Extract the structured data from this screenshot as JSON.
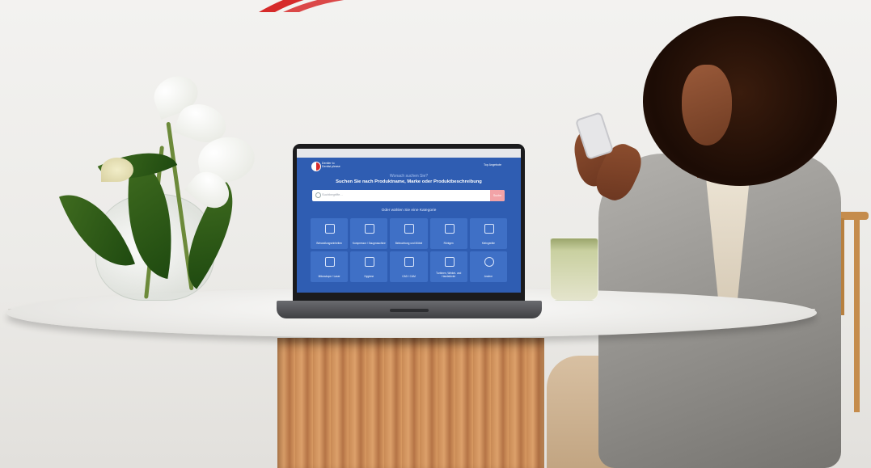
{
  "scene": {
    "subject": "woman-with-phone-at-table",
    "colors": {
      "screen_bg": "#2f5db2",
      "tile_bg": "#3f70c6",
      "accent_red": "#d62a2a",
      "search_button": "#f2a3a7"
    }
  },
  "laptop_screen": {
    "brand": {
      "line1": "Dentler to",
      "line2": "Dentist please"
    },
    "login": "Top Angebote",
    "question": "Wonach suchen Sie?",
    "headline": "Suchen Sie nach Produktname, Marke oder Produktbeschreibung",
    "search": {
      "placeholder": "Suchbegriffe...",
      "button": "Suche"
    },
    "categories_title": "Oder wählen Sie eine Kategorie",
    "categories": [
      {
        "label": "Behandlungseinheiten",
        "icon": "dental-chair-icon"
      },
      {
        "label": "Kompressor / Saugmaschine",
        "icon": "compressor-icon"
      },
      {
        "label": "Beleuchtung und Möbel",
        "icon": "lamp-icon"
      },
      {
        "label": "Röntgen",
        "icon": "xray-icon"
      },
      {
        "label": "Kleingeräte",
        "icon": "handpiece-icon"
      },
      {
        "label": "Mikroskope / Laser",
        "icon": "microscope-icon"
      },
      {
        "label": "Hygiene",
        "icon": "hygiene-icon"
      },
      {
        "label": "CAD / CAM",
        "icon": "cad-cam-icon"
      },
      {
        "label": "Turbinen, Winkel- und Handstücke",
        "icon": "turbine-icon"
      },
      {
        "label": "Andere",
        "icon": "more-icon"
      }
    ]
  }
}
